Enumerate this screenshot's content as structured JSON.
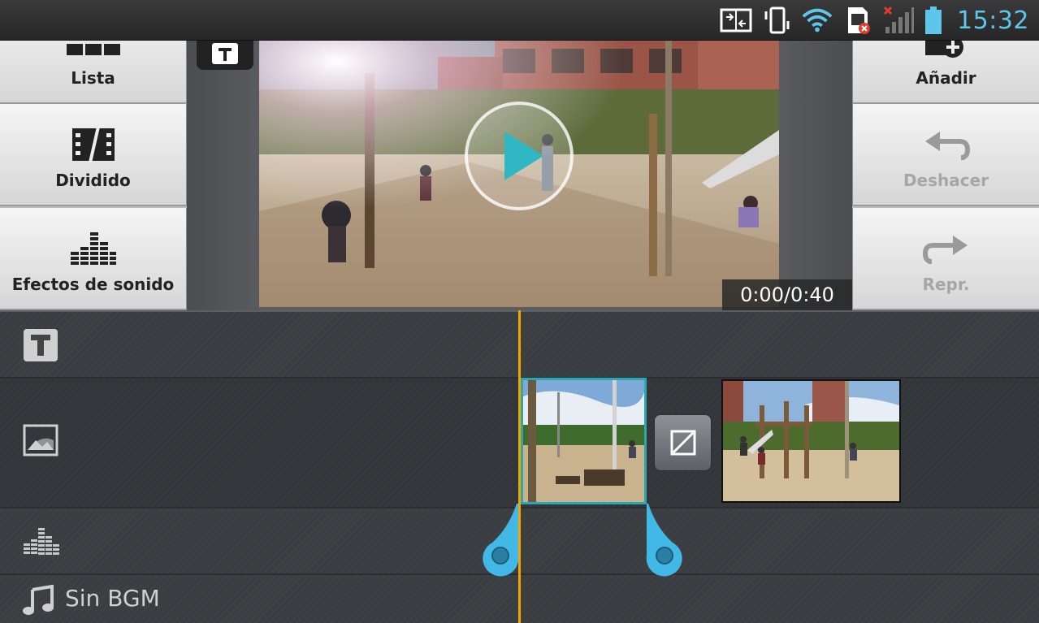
{
  "status_bar": {
    "time": "15:32",
    "icons": [
      "screen-mirroring-icon",
      "vibrate-icon",
      "wifi-icon",
      "sim-error-icon",
      "signal-no-service-icon",
      "battery-icon"
    ]
  },
  "left_menu": {
    "items": [
      {
        "label": "Lista",
        "icon": "list-icon"
      },
      {
        "label": "Dividido",
        "icon": "split-icon"
      },
      {
        "label": "Efectos de sonido",
        "icon": "sound-effects-icon"
      }
    ]
  },
  "right_menu": {
    "items": [
      {
        "label": "Añadir",
        "icon": "add-icon",
        "enabled": true
      },
      {
        "label": "Deshacer",
        "icon": "undo-icon",
        "enabled": false
      },
      {
        "label": "Repr.",
        "icon": "redo-icon",
        "enabled": false
      }
    ]
  },
  "preview": {
    "time_display": "0:00/0:40",
    "play_icon": "play-icon"
  },
  "timeline": {
    "tracks": [
      {
        "name": "text-track",
        "icon": "text-icon"
      },
      {
        "name": "image-track",
        "icon": "image-icon"
      },
      {
        "name": "sound-track",
        "icon": "sound-effects-icon"
      },
      {
        "name": "bgm-track",
        "icon": "music-note-icon",
        "label": "Sin BGM"
      }
    ],
    "clips": [
      "clip-1",
      "clip-2"
    ],
    "transition_icon": "transition-icon"
  },
  "colors": {
    "accent": "#2aa7b0",
    "playhead": "#f0a800",
    "handle": "#42b8e6",
    "clock": "#5ec6ea"
  }
}
